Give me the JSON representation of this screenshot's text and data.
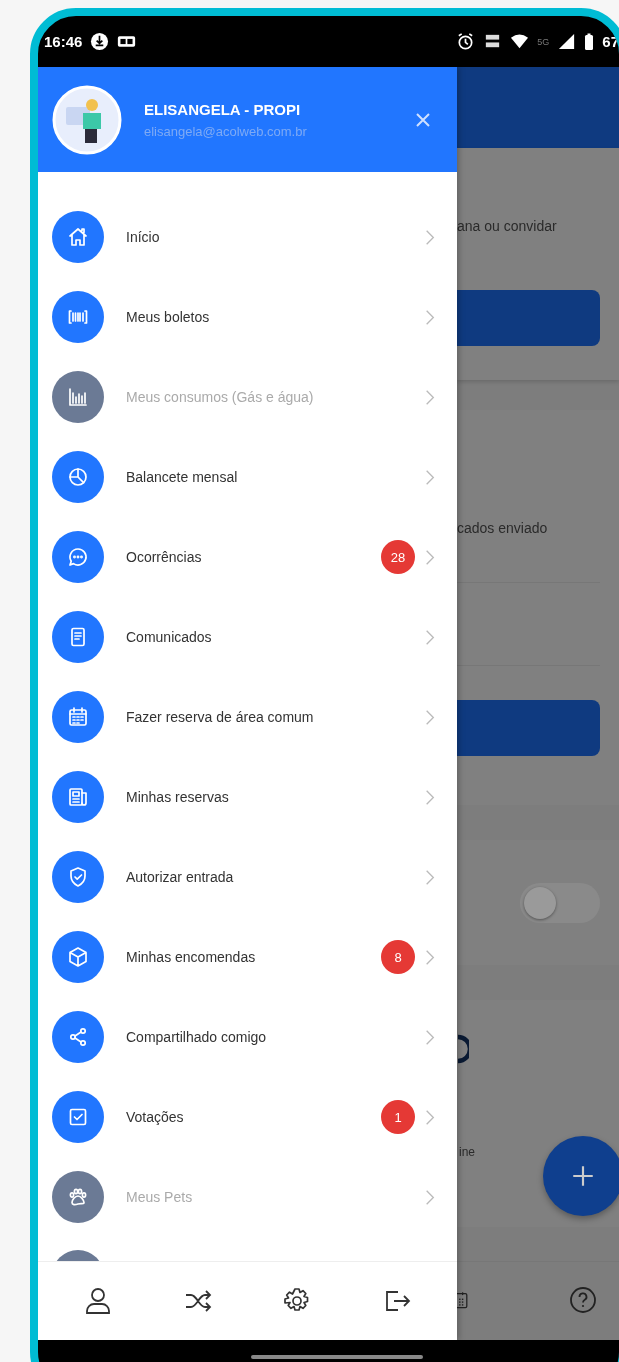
{
  "status_bar": {
    "time": "16:46",
    "network": "5G",
    "battery": "67"
  },
  "drawer": {
    "user": {
      "name": "ELISANGELA - PROPI",
      "email": "elisangela@acolweb.com.br"
    },
    "items": [
      {
        "label": "Início",
        "disabled": false
      },
      {
        "label": "Meus boletos",
        "disabled": false
      },
      {
        "label": "Meus consumos (Gás e água)",
        "disabled": true
      },
      {
        "label": "Balancete mensal",
        "disabled": false
      },
      {
        "label": "Ocorrências",
        "disabled": false,
        "badge": "28"
      },
      {
        "label": "Comunicados",
        "disabled": false
      },
      {
        "label": "Fazer reserva de área comum",
        "disabled": false
      },
      {
        "label": "Minhas reservas",
        "disabled": false
      },
      {
        "label": "Autorizar entrada",
        "disabled": false
      },
      {
        "label": "Minhas encomendas",
        "disabled": false,
        "badge": "8"
      },
      {
        "label": "Compartilhado comigo",
        "disabled": false
      },
      {
        "label": "Votações",
        "disabled": false,
        "badge": "1"
      },
      {
        "label": "Meus Pets",
        "disabled": true
      }
    ]
  },
  "background": {
    "texts": [
      "ana ou convidar",
      "cados enviado",
      "ine"
    ],
    "toggle": {
      "on": false
    }
  }
}
